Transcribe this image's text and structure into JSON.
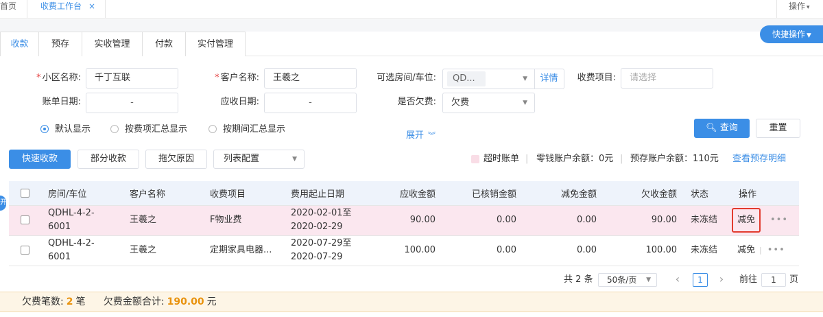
{
  "top_tabs": {
    "home": "首页",
    "active": "收费工作台",
    "close": "×",
    "ops": "操作"
  },
  "quick_ops": "快捷操作",
  "sub_tabs": [
    "收款",
    "预存",
    "实收管理",
    "付款",
    "实付管理"
  ],
  "form": {
    "community_label": "小区名称:",
    "community_value": "千丁互联",
    "customer_label": "客户名称:",
    "customer_value": "王羲之",
    "room_label": "可选房间/车位:",
    "room_value": "QD...",
    "detail_btn": "详情",
    "fee_item_label": "收费项目:",
    "fee_item_placeholder": "请选择",
    "bill_date_label": "账单日期:",
    "bill_date_value": "-",
    "due_date_label": "应收日期:",
    "due_date_value": "-",
    "arrears_label": "是否欠费:",
    "arrears_value": "欠费",
    "required_mark": "*"
  },
  "radios": [
    "默认显示",
    "按费项汇总显示",
    "按期间汇总显示"
  ],
  "expand": "展开",
  "query_btn": "查询",
  "reset_btn": "重置",
  "actions": {
    "quick_collect": "快速收款",
    "partial": "部分收款",
    "arrears_reason": "拖欠原因",
    "column_config": "列表配置"
  },
  "info": {
    "overtime": "超时账单",
    "change_balance": "零钱账户余额：0元",
    "prestore_balance": "预存账户余额：110元",
    "view_prestore": "查看预存明细",
    "sep": "|"
  },
  "table": {
    "headers": [
      "房间/车位",
      "客户名称",
      "收费项目",
      "费用起止日期",
      "应收金额",
      "已核销金额",
      "减免金额",
      "欠收金额",
      "状态",
      "操作"
    ],
    "rows": [
      {
        "room": "QDHL-4-2-6001",
        "customer": "王羲之",
        "item": "F物业费",
        "period": "2020-02-01至2020-02-29",
        "receivable": "90.00",
        "written_off": "0.00",
        "discount": "0.00",
        "owed": "90.00",
        "status": "未冻结",
        "op": "减免",
        "more": "•••"
      },
      {
        "room": "QDHL-4-2-6001",
        "customer": "王羲之",
        "item": "定期家具电器...",
        "period": "2020-07-29至2020-07-29",
        "receivable": "100.00",
        "written_off": "0.00",
        "discount": "0.00",
        "owed": "100.00",
        "status": "未冻结",
        "op": "减免",
        "more": "•••"
      }
    ]
  },
  "side_tab": "开",
  "pagination": {
    "total": "共 2 条",
    "per_page": "50条/页",
    "current": "1",
    "goto": "前往",
    "goto_value": "1",
    "page_unit": "页"
  },
  "summary": {
    "count_label": "欠费笔数:",
    "count": "2",
    "count_unit": "笔",
    "amount_label": "欠费金额合计:",
    "amount": "190.00",
    "amount_unit": "元"
  },
  "colors": {
    "accent": "#3b8ee6",
    "highlight_row": "#fbe7ef",
    "summary_bg": "#fdf5e6",
    "summary_num": "#e8920d",
    "outline": "#e23b2e"
  }
}
